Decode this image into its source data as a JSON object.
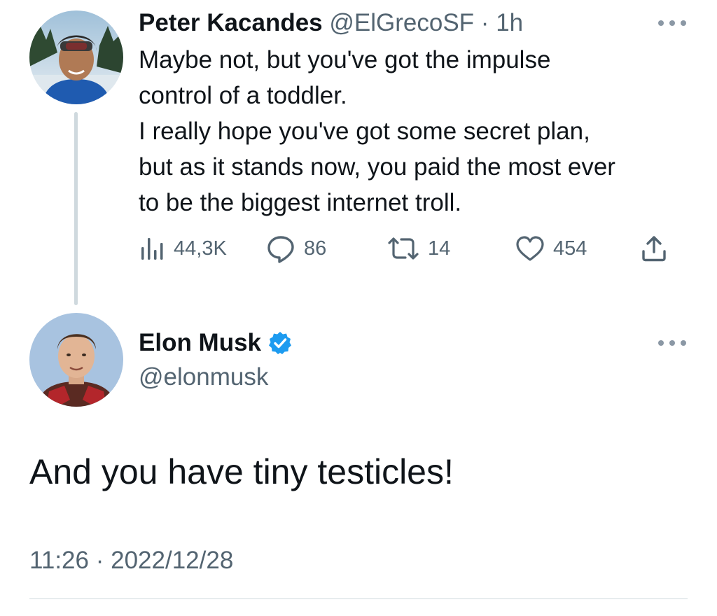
{
  "reply": {
    "display_name": "Peter Kacandes",
    "handle": "@ElGrecoSF",
    "separator": "·",
    "time": "1h",
    "text_lines": [
      "Maybe not, but you've got the impulse",
      "control of a toddler.",
      "I really hope you've got some secret plan,",
      "but as it stands now, you paid the most ever",
      "to be the biggest internet troll."
    ],
    "stats": {
      "views": "44,3K",
      "replies": "86",
      "retweets": "14",
      "likes": "454"
    },
    "icons": [
      "views-icon",
      "reply-icon",
      "retweet-icon",
      "like-icon",
      "share-icon",
      "more-icon"
    ]
  },
  "main": {
    "display_name": "Elon Musk",
    "handle": "@elonmusk",
    "verified": true,
    "text": "And you have tiny testicles!",
    "time": "11:26",
    "separator": "·",
    "date": "2022/12/28"
  },
  "colors": {
    "text": "#0f1419",
    "secondary": "#536471",
    "verified": "#1d9bf0",
    "divider": "#cfd9de"
  }
}
